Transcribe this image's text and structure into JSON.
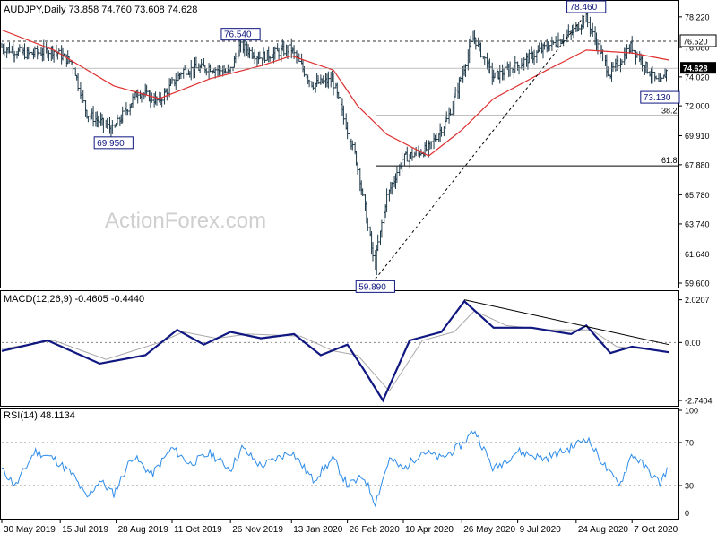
{
  "chart_data": [
    {
      "type": "ohlc",
      "panel": "price",
      "title": "AUDJPY,Daily",
      "ohlc_text": "73.858 74.760 73.608 74.628",
      "watermark": "ActionForex.com",
      "ylim": [
        59.6,
        78.9
      ],
      "yticks": [
        "78.220",
        "76.080",
        "74.020",
        "72.000",
        "69.910",
        "67.880",
        "65.780",
        "63.740",
        "61.640",
        "59.600"
      ],
      "ytick_values": [
        78.22,
        76.08,
        74.02,
        72.0,
        69.91,
        67.88,
        65.78,
        63.74,
        61.64,
        59.6
      ],
      "current_price": "74.628",
      "current_price_value": 74.628,
      "resistance_level": "76.520",
      "resistance_value": 76.52,
      "fib_levels": [
        {
          "label": "38.2",
          "value": 71.3
        },
        {
          "label": "61.8",
          "value": 67.8
        }
      ],
      "annotations": [
        {
          "label": "76.540",
          "date": "2019-12-04",
          "value": 76.54
        },
        {
          "label": "69.950",
          "date": "2019-08-26",
          "value": 69.95
        },
        {
          "label": "59.890",
          "date": "2020-03-19",
          "value": 59.89
        },
        {
          "label": "78.460",
          "date": "2020-09-01",
          "value": 78.46
        },
        {
          "label": "73.130",
          "date": "2020-10-29",
          "value": 73.13
        }
      ],
      "trendline": {
        "from": {
          "date": "2020-03-19",
          "value": 59.89
        },
        "to": {
          "date": "2020-09-01",
          "value": 78.46
        }
      },
      "ma_series_name": "",
      "price_series": [
        {
          "date": "2019-05-30",
          "close": 76.1
        },
        {
          "date": "2019-06-20",
          "close": 75.6
        },
        {
          "date": "2019-07-10",
          "close": 75.9
        },
        {
          "date": "2019-07-25",
          "close": 75.0
        },
        {
          "date": "2019-08-05",
          "close": 71.5
        },
        {
          "date": "2019-08-26",
          "close": 70.3
        },
        {
          "date": "2019-09-15",
          "close": 73.0
        },
        {
          "date": "2019-10-01",
          "close": 72.3
        },
        {
          "date": "2019-10-20",
          "close": 74.5
        },
        {
          "date": "2019-11-10",
          "close": 74.7
        },
        {
          "date": "2019-11-26",
          "close": 74.3
        },
        {
          "date": "2019-12-04",
          "close": 76.2
        },
        {
          "date": "2019-12-20",
          "close": 75.4
        },
        {
          "date": "2020-01-13",
          "close": 76.0
        },
        {
          "date": "2020-01-30",
          "close": 73.5
        },
        {
          "date": "2020-02-15",
          "close": 73.8
        },
        {
          "date": "2020-02-26",
          "close": 70.5
        },
        {
          "date": "2020-03-05",
          "close": 68.0
        },
        {
          "date": "2020-03-19",
          "close": 60.8
        },
        {
          "date": "2020-03-28",
          "close": 65.5
        },
        {
          "date": "2020-04-10",
          "close": 68.3
        },
        {
          "date": "2020-04-30",
          "close": 69.0
        },
        {
          "date": "2020-05-15",
          "close": 71.0
        },
        {
          "date": "2020-05-26",
          "close": 74.0
        },
        {
          "date": "2020-06-05",
          "close": 76.9
        },
        {
          "date": "2020-06-20",
          "close": 74.0
        },
        {
          "date": "2020-07-09",
          "close": 74.8
        },
        {
          "date": "2020-07-30",
          "close": 76.0
        },
        {
          "date": "2020-08-20",
          "close": 77.0
        },
        {
          "date": "2020-09-01",
          "close": 78.2
        },
        {
          "date": "2020-09-20",
          "close": 74.2
        },
        {
          "date": "2020-10-07",
          "close": 76.2
        },
        {
          "date": "2020-10-29",
          "close": 73.4
        },
        {
          "date": "2020-11-05",
          "close": 74.628
        }
      ],
      "ma_series": [
        {
          "date": "2019-05-30",
          "value": 77.3
        },
        {
          "date": "2019-07-10",
          "value": 75.9
        },
        {
          "date": "2019-08-26",
          "value": 73.4
        },
        {
          "date": "2019-10-01",
          "value": 72.5
        },
        {
          "date": "2019-11-10",
          "value": 73.9
        },
        {
          "date": "2019-12-20",
          "value": 74.8
        },
        {
          "date": "2020-01-13",
          "value": 75.5
        },
        {
          "date": "2020-02-15",
          "value": 74.5
        },
        {
          "date": "2020-03-05",
          "value": 72.0
        },
        {
          "date": "2020-03-28",
          "value": 70.0
        },
        {
          "date": "2020-04-30",
          "value": 68.5
        },
        {
          "date": "2020-05-26",
          "value": 70.3
        },
        {
          "date": "2020-06-20",
          "value": 72.5
        },
        {
          "date": "2020-08-01",
          "value": 74.5
        },
        {
          "date": "2020-09-01",
          "value": 75.9
        },
        {
          "date": "2020-10-07",
          "value": 75.7
        },
        {
          "date": "2020-11-05",
          "value": 75.2
        }
      ]
    },
    {
      "type": "line",
      "panel": "macd",
      "title": "MACD(12,26,9) -0.4605 -0.4440",
      "ylim": [
        -2.95,
        2.3
      ],
      "yticks": [
        "2.0207",
        "0.00",
        "-2.7404"
      ],
      "ytick_values": [
        2.0207,
        0.0,
        -2.7404
      ],
      "zero_line": 0,
      "macd_series": [
        {
          "date": "2019-05-30",
          "value": -0.4
        },
        {
          "date": "2019-07-05",
          "value": 0.1
        },
        {
          "date": "2019-08-15",
          "value": -1.0
        },
        {
          "date": "2019-09-20",
          "value": -0.6
        },
        {
          "date": "2019-10-15",
          "value": 0.6
        },
        {
          "date": "2019-11-05",
          "value": -0.1
        },
        {
          "date": "2019-11-26",
          "value": 0.5
        },
        {
          "date": "2019-12-20",
          "value": 0.2
        },
        {
          "date": "2020-01-15",
          "value": 0.4
        },
        {
          "date": "2020-02-05",
          "value": -0.6
        },
        {
          "date": "2020-02-26",
          "value": -0.1
        },
        {
          "date": "2020-03-10",
          "value": -1.3
        },
        {
          "date": "2020-03-25",
          "value": -2.74
        },
        {
          "date": "2020-04-15",
          "value": 0.1
        },
        {
          "date": "2020-05-10",
          "value": 0.5
        },
        {
          "date": "2020-05-28",
          "value": 1.95
        },
        {
          "date": "2020-06-20",
          "value": 0.7
        },
        {
          "date": "2020-07-20",
          "value": 0.7
        },
        {
          "date": "2020-08-20",
          "value": 0.4
        },
        {
          "date": "2020-09-01",
          "value": 0.8
        },
        {
          "date": "2020-09-20",
          "value": -0.5
        },
        {
          "date": "2020-10-07",
          "value": -0.2
        },
        {
          "date": "2020-11-05",
          "value": -0.4605
        }
      ],
      "signal_series": [
        {
          "date": "2019-05-30",
          "value": -0.3
        },
        {
          "date": "2019-07-10",
          "value": 0.1
        },
        {
          "date": "2019-08-20",
          "value": -0.8
        },
        {
          "date": "2019-10-01",
          "value": 0.0
        },
        {
          "date": "2019-10-20",
          "value": 0.5
        },
        {
          "date": "2019-11-15",
          "value": 0.2
        },
        {
          "date": "2019-12-10",
          "value": 0.4
        },
        {
          "date": "2020-01-20",
          "value": 0.3
        },
        {
          "date": "2020-02-15",
          "value": -0.4
        },
        {
          "date": "2020-03-05",
          "value": -0.6
        },
        {
          "date": "2020-03-30",
          "value": -2.3
        },
        {
          "date": "2020-04-25",
          "value": 0.1
        },
        {
          "date": "2020-05-20",
          "value": 0.5
        },
        {
          "date": "2020-06-05",
          "value": 1.5
        },
        {
          "date": "2020-06-30",
          "value": 0.8
        },
        {
          "date": "2020-08-01",
          "value": 0.6
        },
        {
          "date": "2020-09-05",
          "value": 0.6
        },
        {
          "date": "2020-09-25",
          "value": -0.2
        },
        {
          "date": "2020-10-15",
          "value": -0.3
        },
        {
          "date": "2020-11-05",
          "value": -0.444
        }
      ],
      "trendline": {
        "from": {
          "date": "2020-05-28",
          "value": 2.02
        },
        "to": {
          "date": "2020-11-05",
          "value": -0.1
        }
      }
    },
    {
      "type": "line",
      "panel": "rsi",
      "title": "RSI(14) 48.1134",
      "ylim": [
        0,
        100
      ],
      "yticks": [
        "100",
        "70",
        "30",
        "0"
      ],
      "ytick_values": [
        100,
        70,
        30,
        0
      ],
      "levels": [
        70,
        30
      ],
      "rsi_series": [
        {
          "date": "2019-05-30",
          "value": 45
        },
        {
          "date": "2019-06-10",
          "value": 30
        },
        {
          "date": "2019-06-25",
          "value": 62
        },
        {
          "date": "2019-07-10",
          "value": 55
        },
        {
          "date": "2019-07-25",
          "value": 40
        },
        {
          "date": "2019-08-05",
          "value": 18
        },
        {
          "date": "2019-08-15",
          "value": 35
        },
        {
          "date": "2019-08-26",
          "value": 22
        },
        {
          "date": "2019-09-10",
          "value": 58
        },
        {
          "date": "2019-09-25",
          "value": 40
        },
        {
          "date": "2019-10-11",
          "value": 65
        },
        {
          "date": "2019-10-25",
          "value": 50
        },
        {
          "date": "2019-11-10",
          "value": 60
        },
        {
          "date": "2019-11-26",
          "value": 45
        },
        {
          "date": "2019-12-05",
          "value": 65
        },
        {
          "date": "2019-12-20",
          "value": 48
        },
        {
          "date": "2020-01-13",
          "value": 62
        },
        {
          "date": "2020-01-30",
          "value": 35
        },
        {
          "date": "2020-02-15",
          "value": 55
        },
        {
          "date": "2020-02-26",
          "value": 30
        },
        {
          "date": "2020-03-10",
          "value": 38
        },
        {
          "date": "2020-03-19",
          "value": 14
        },
        {
          "date": "2020-03-30",
          "value": 55
        },
        {
          "date": "2020-04-10",
          "value": 45
        },
        {
          "date": "2020-04-25",
          "value": 62
        },
        {
          "date": "2020-05-10",
          "value": 55
        },
        {
          "date": "2020-05-26",
          "value": 68
        },
        {
          "date": "2020-06-05",
          "value": 82
        },
        {
          "date": "2020-06-20",
          "value": 45
        },
        {
          "date": "2020-07-09",
          "value": 62
        },
        {
          "date": "2020-07-30",
          "value": 55
        },
        {
          "date": "2020-08-20",
          "value": 65
        },
        {
          "date": "2020-09-01",
          "value": 75
        },
        {
          "date": "2020-09-20",
          "value": 40
        },
        {
          "date": "2020-09-28",
          "value": 32
        },
        {
          "date": "2020-10-07",
          "value": 60
        },
        {
          "date": "2020-10-29",
          "value": 32
        },
        {
          "date": "2020-11-05",
          "value": 48.1134
        }
      ]
    }
  ],
  "x_axis": {
    "labels": [
      {
        "label": "30 May 2019",
        "date": "2019-05-30"
      },
      {
        "label": "15 Jul 2019",
        "date": "2019-07-15"
      },
      {
        "label": "28 Aug 2019",
        "date": "2019-08-28"
      },
      {
        "label": "11 Oct 2019",
        "date": "2019-10-11"
      },
      {
        "label": "26 Nov 2019",
        "date": "2019-11-26"
      },
      {
        "label": "13 Jan 2020",
        "date": "2020-01-13"
      },
      {
        "label": "26 Feb 2020",
        "date": "2020-02-26"
      },
      {
        "label": "10 Apr 2020",
        "date": "2020-04-10"
      },
      {
        "label": "26 May 2020",
        "date": "2020-05-26"
      },
      {
        "label": "9 Jul 2020",
        "date": "2020-07-09"
      },
      {
        "label": "24 Aug 2020",
        "date": "2020-08-24"
      },
      {
        "label": "7 Oct 2020",
        "date": "2020-10-07"
      }
    ],
    "range": [
      "2019-05-30",
      "2020-11-09"
    ]
  },
  "colors": {
    "price_bars": "#1f3a4a",
    "moving_average": "#e03030",
    "macd_line": "#101780",
    "signal_line": "#a8a8a8",
    "rsi_line": "#2e8ce8",
    "trendline": "#000000",
    "grid_dash": "#888888",
    "label_border": "#101780",
    "label_text": "#101780",
    "price_box_bg": "#000000",
    "price_box_text": "#ffffff",
    "watermark": "#cfcfcf"
  }
}
